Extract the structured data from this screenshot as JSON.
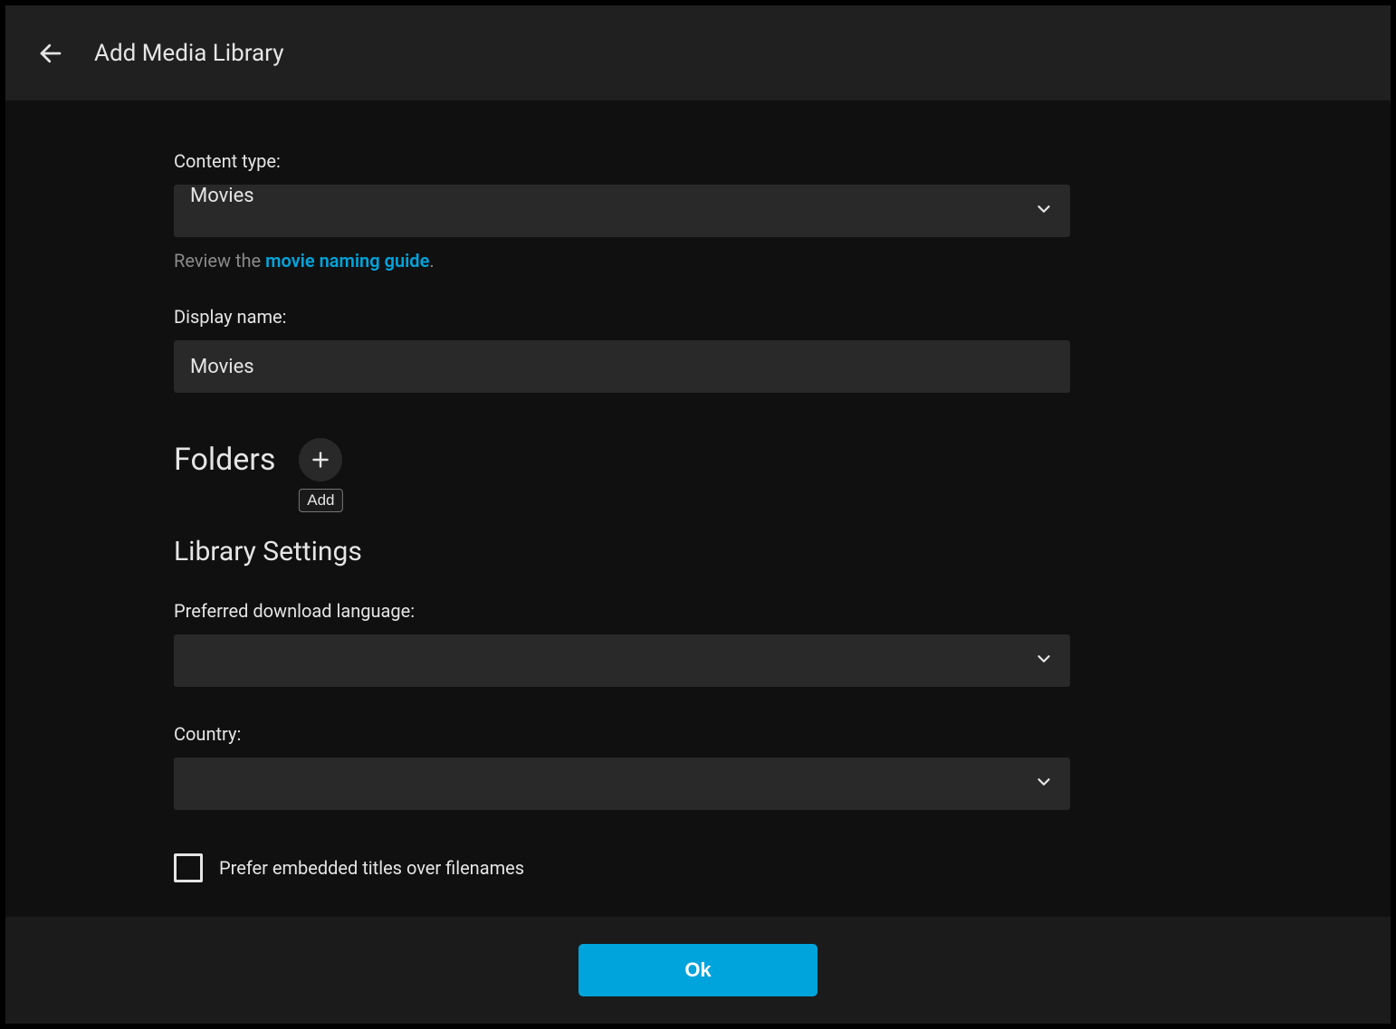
{
  "header": {
    "title": "Add Media Library"
  },
  "contentType": {
    "label": "Content type:",
    "value": "Movies",
    "helperPrefix": "Review the ",
    "helperLink": "movie naming guide",
    "helperSuffix": "."
  },
  "displayName": {
    "label": "Display name:",
    "value": "Movies"
  },
  "folders": {
    "title": "Folders",
    "addTooltip": "Add"
  },
  "librarySettings": {
    "title": "Library Settings",
    "preferredLanguage": {
      "label": "Preferred download language:",
      "value": ""
    },
    "country": {
      "label": "Country:",
      "value": ""
    },
    "preferEmbedded": {
      "label": "Prefer embedded titles over filenames",
      "checked": false
    }
  },
  "footer": {
    "okLabel": "Ok"
  }
}
